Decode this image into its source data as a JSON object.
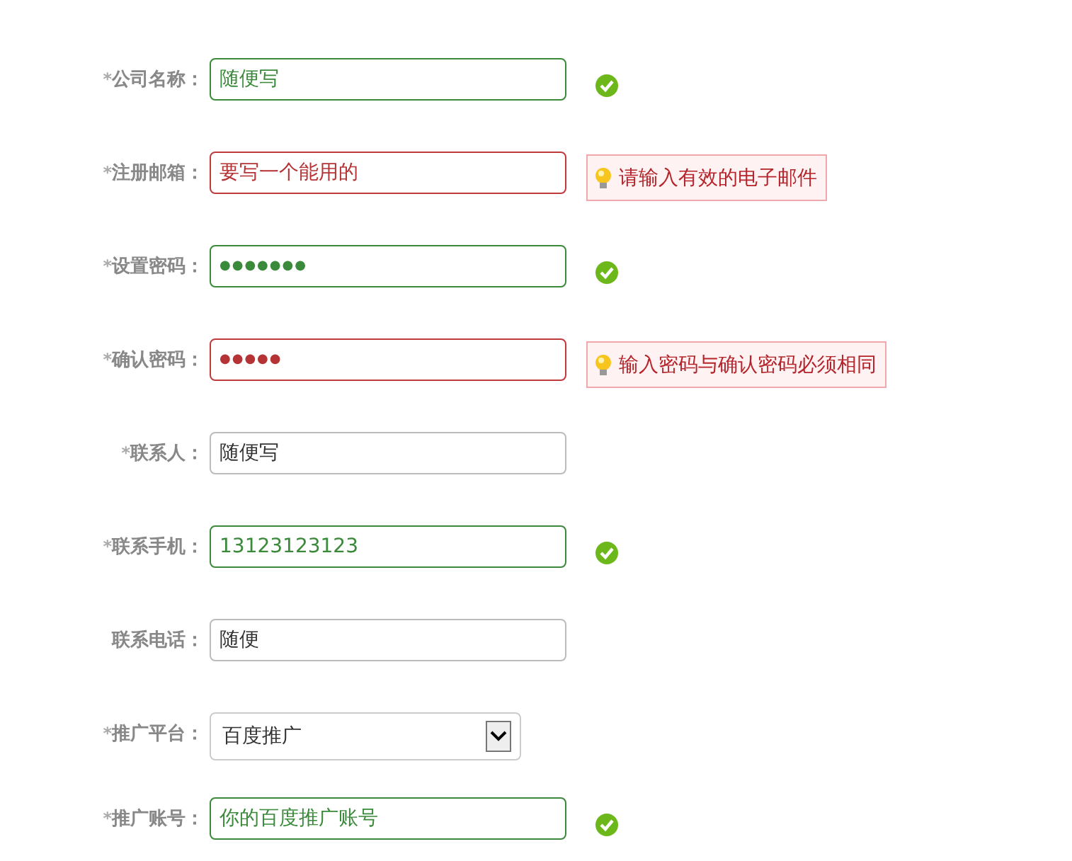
{
  "fields": [
    {
      "kind": "text",
      "marker": "*",
      "label": "公司名称：",
      "value": "随便写",
      "valid": true,
      "error": false
    },
    {
      "kind": "text",
      "marker": "*",
      "label": "注册邮箱：",
      "value": "要写一个能用的",
      "valid": false,
      "error": true,
      "message": "请输入有效的电子邮件"
    },
    {
      "kind": "password",
      "marker": "*",
      "label": "设置密码：",
      "value": "●●●●●●●",
      "valid": true,
      "error": false
    },
    {
      "kind": "password",
      "marker": "*",
      "label": "确认密码：",
      "value": "●●●●●",
      "valid": false,
      "error": true,
      "message": "输入密码与确认密码必须相同"
    },
    {
      "kind": "text",
      "marker": "*",
      "label": "联系人：",
      "value": "随便写",
      "valid": false,
      "error": false
    },
    {
      "kind": "text",
      "marker": "*",
      "label": "联系手机：",
      "value": "13123123123",
      "valid": true,
      "error": false
    },
    {
      "kind": "text",
      "label": "联系电话：",
      "value": "随便",
      "valid": false,
      "error": false
    },
    {
      "kind": "select",
      "marker": "*",
      "label": "推广平台：",
      "value": "百度推广",
      "valid": false,
      "error": false
    },
    {
      "kind": "text",
      "marker": "*",
      "label": "推广账号：",
      "value": "你的百度推广账号",
      "valid": true,
      "error": false
    }
  ]
}
